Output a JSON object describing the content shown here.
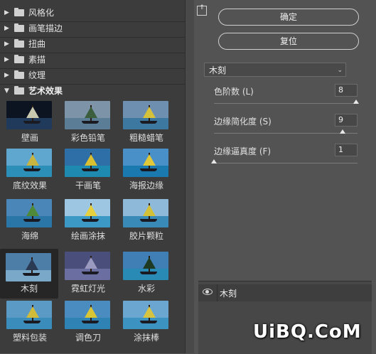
{
  "categories": [
    {
      "label": "风格化",
      "expanded": false
    },
    {
      "label": "画笔描边",
      "expanded": false
    },
    {
      "label": "扭曲",
      "expanded": false
    },
    {
      "label": "素描",
      "expanded": false
    },
    {
      "label": "纹理",
      "expanded": false
    },
    {
      "label": "艺术效果",
      "expanded": true
    }
  ],
  "filters": [
    {
      "label": "壁画",
      "selected": false
    },
    {
      "label": "彩色铅笔",
      "selected": false
    },
    {
      "label": "粗糙蜡笔",
      "selected": false
    },
    {
      "label": "底纹效果",
      "selected": false
    },
    {
      "label": "干画笔",
      "selected": false
    },
    {
      "label": "海报边缘",
      "selected": false
    },
    {
      "label": "海绵",
      "selected": false
    },
    {
      "label": "绘画涂抹",
      "selected": false
    },
    {
      "label": "胶片颗粒",
      "selected": false
    },
    {
      "label": "木刻",
      "selected": true
    },
    {
      "label": "霓虹灯光",
      "selected": false
    },
    {
      "label": "水彩",
      "selected": false
    },
    {
      "label": "塑料包装",
      "selected": false
    },
    {
      "label": "调色刀",
      "selected": false
    },
    {
      "label": "涂抹棒",
      "selected": false
    }
  ],
  "buttons": {
    "ok": "确定",
    "reset": "复位"
  },
  "collapse_icon": "collapse-panel-icon",
  "current_filter": "木刻",
  "params": [
    {
      "label": "色阶数 (L)",
      "value": "8",
      "fraction": 1.0
    },
    {
      "label": "边缘简化度 (S)",
      "value": "9",
      "fraction": 0.9
    },
    {
      "label": "边缘逼真度 (F)",
      "value": "1",
      "fraction": 0.0
    }
  ],
  "layer": {
    "name": "木刻",
    "visible": true
  },
  "watermark": "UiBQ.CoM",
  "colors": {
    "panel": "#535353",
    "list": "#3c3c3c",
    "selected": "#262626"
  }
}
